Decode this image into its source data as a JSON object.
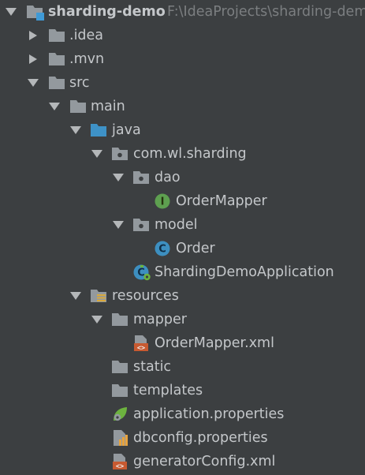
{
  "project_tree": {
    "root": {
      "label": "sharding-demo",
      "path": "F:\\IdeaProjects\\sharding-demo"
    },
    "items": [
      {
        "label": ".idea"
      },
      {
        "label": ".mvn"
      },
      {
        "label": "src"
      },
      {
        "label": "main"
      },
      {
        "label": "java"
      },
      {
        "label": "com.wl.sharding"
      },
      {
        "label": "dao"
      },
      {
        "label": "OrderMapper",
        "badge": "I"
      },
      {
        "label": "model"
      },
      {
        "label": "Order",
        "badge": "C"
      },
      {
        "label": "ShardingDemoApplication",
        "badge": "C"
      },
      {
        "label": "resources"
      },
      {
        "label": "mapper"
      },
      {
        "label": "OrderMapper.xml",
        "badge": "<>"
      },
      {
        "label": "static"
      },
      {
        "label": "templates"
      },
      {
        "label": "application.properties"
      },
      {
        "label": "dbconfig.properties"
      },
      {
        "label": "generatorConfig.xml",
        "badge": "<>"
      }
    ]
  }
}
